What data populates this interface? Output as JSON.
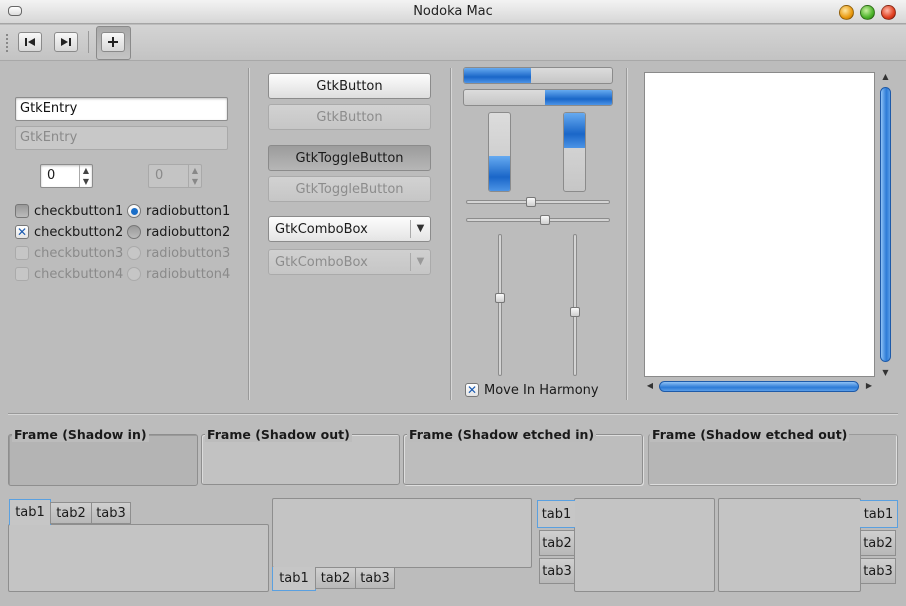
{
  "window": {
    "title": "Nodoka Mac"
  },
  "toolbar": {
    "buttons": [
      {
        "icon": "skip-back-icon"
      },
      {
        "icon": "skip-forward-icon"
      },
      {
        "icon": "plus-icon"
      }
    ]
  },
  "entries": {
    "enabled_value": "GtkEntry",
    "disabled_value": "GtkEntry"
  },
  "spinbuttons": {
    "enabled_value": "0",
    "disabled_value": "0"
  },
  "checkbuttons": [
    "checkbutton1",
    "checkbutton2",
    "checkbutton3",
    "checkbutton4"
  ],
  "radiobuttons": [
    "radiobutton1",
    "radiobutton2",
    "radiobutton3",
    "radiobutton4"
  ],
  "buttons": {
    "button": "GtkButton",
    "button_disabled": "GtkButton",
    "toggle": "GtkToggleButton",
    "toggle_disabled": "GtkToggleButton",
    "combo": "GtkComboBox",
    "combo_disabled": "GtkComboBox"
  },
  "progress": {
    "h1": 0.45,
    "h2": 0.45,
    "v1": 0.45,
    "v2": 0.45
  },
  "scales": {
    "h1": 0.45,
    "h2": 0.55,
    "v1": 0.45,
    "v2": 0.55
  },
  "harmony": {
    "label": "Move In Harmony",
    "checked": true
  },
  "frames": {
    "shadow_in": "Frame (Shadow in)",
    "shadow_out": "Frame (Shadow out)",
    "etched_in": "Frame (Shadow etched in)",
    "etched_out": "Frame (Shadow etched out)"
  },
  "notebooks": {
    "tabs": [
      "tab1",
      "tab2",
      "tab3"
    ]
  },
  "colors": {
    "accent": "#2c7ad6",
    "check": "#1a5ab0"
  }
}
